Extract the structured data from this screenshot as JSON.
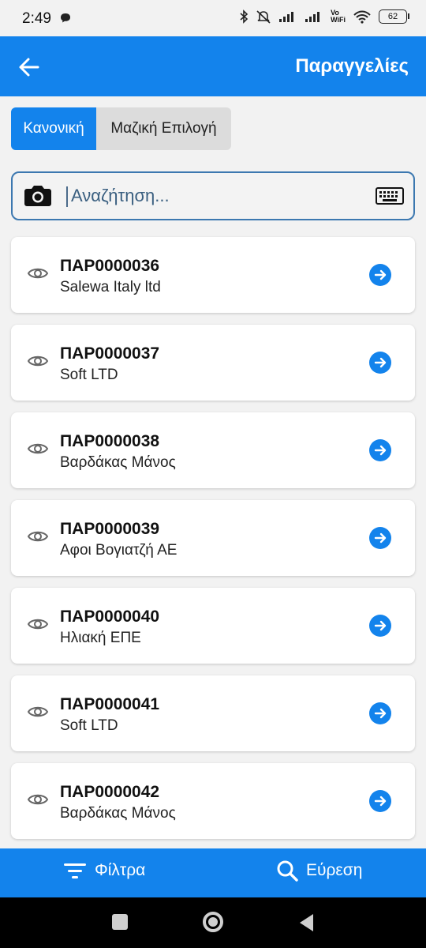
{
  "status": {
    "time": "2:49",
    "vowifi_top": "Vo",
    "vowifi_bottom": "WiFi",
    "battery": "62"
  },
  "header": {
    "title": "Παραγγελίες",
    "back_icon": "arrow-left-icon"
  },
  "mode_tabs": {
    "normal": "Κανονική",
    "bulk": "Μαζική Επιλογή"
  },
  "search": {
    "placeholder": "Αναζήτηση...",
    "value": ""
  },
  "orders": [
    {
      "code": "ΠΑΡ0000036",
      "customer": "Salewa Italy ltd"
    },
    {
      "code": "ΠΑΡ0000037",
      "customer": "Soft LTD"
    },
    {
      "code": "ΠΑΡ0000038",
      "customer": "Βαρδάκας Μάνος"
    },
    {
      "code": "ΠΑΡ0000039",
      "customer": "Αφοι Βογιατζή ΑΕ"
    },
    {
      "code": "ΠΑΡ0000040",
      "customer": "Ηλιακή ΕΠΕ"
    },
    {
      "code": "ΠΑΡ0000041",
      "customer": "Soft LTD"
    },
    {
      "code": "ΠΑΡ0000042",
      "customer": "Βαρδάκας Μάνος"
    }
  ],
  "bottom_bar": {
    "filters": "Φίλτρα",
    "find": "Εύρεση"
  },
  "colors": {
    "accent": "#1383ec",
    "background": "#f2f2f2"
  }
}
